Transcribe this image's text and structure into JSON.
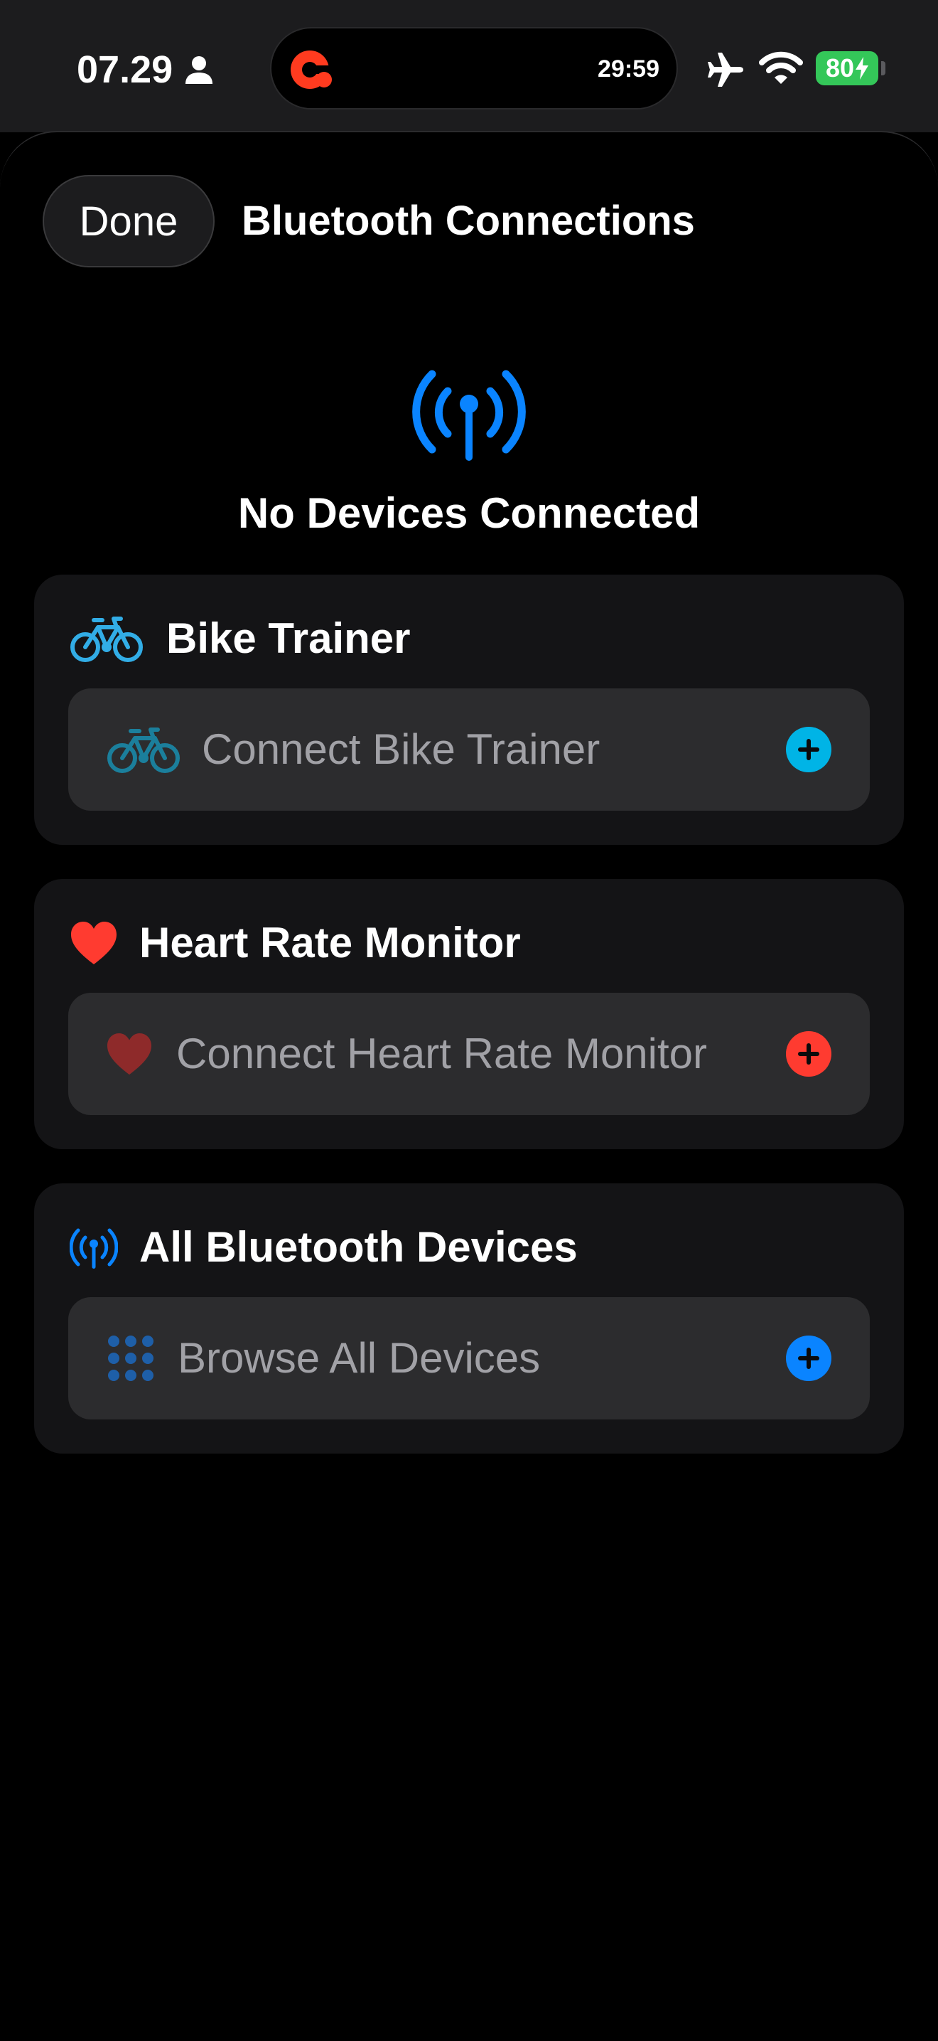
{
  "status_bar": {
    "time": "07.29",
    "person_icon": "person-fill-icon",
    "live_activity_timer": "29:59",
    "app_icon": "app-logo-icon",
    "airplane_icon": "airplane-icon",
    "wifi_icon": "wifi-icon",
    "battery_level": "80",
    "battery_color": "#34c759"
  },
  "nav": {
    "done_label": "Done",
    "title": "Bluetooth Connections"
  },
  "hero": {
    "icon": "antenna-radiowaves-icon",
    "title": "No Devices Connected",
    "accent_color": "#0a84ff"
  },
  "sections": [
    {
      "title": "Bike Trainer",
      "icon": "bicycle-icon",
      "icon_color": "#32ade6",
      "row_label": "Connect Bike Trainer",
      "row_icon": "bicycle-icon",
      "row_icon_color": "#1b7f9c",
      "action_icon": "plus-circle-icon",
      "action_color": "#00b4e6"
    },
    {
      "title": "Heart Rate Monitor",
      "icon": "heart-icon",
      "icon_color": "#ff3b30",
      "row_label": "Connect Heart Rate Monitor",
      "row_icon": "heart-icon",
      "row_icon_color": "#8e2a2a",
      "action_icon": "plus-circle-icon",
      "action_color": "#ff3b30"
    },
    {
      "title": "All Bluetooth Devices",
      "icon": "antenna-radiowaves-icon",
      "icon_color": "#0a84ff",
      "row_label": "Browse All Devices",
      "row_icon": "grid-dots-icon",
      "row_icon_color": "#1e5fa8",
      "action_icon": "plus-circle-icon",
      "action_color": "#0a84ff"
    }
  ]
}
